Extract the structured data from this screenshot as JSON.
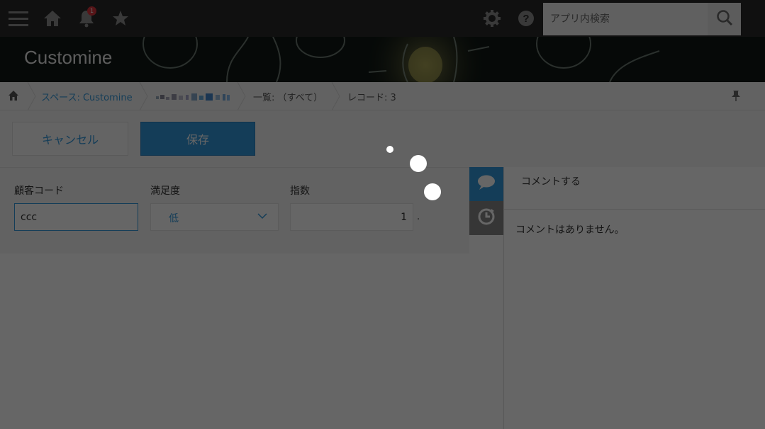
{
  "topbar": {
    "notification_count": "1",
    "search": {
      "placeholder": "アプリ内検索"
    }
  },
  "header": {
    "title": "Customine"
  },
  "breadcrumb": {
    "space": "スペース: Customine",
    "list": "一覧: （すべて）",
    "record": "レコード: 3"
  },
  "toolbar": {
    "cancel_label": "キャンセル",
    "save_label": "保存"
  },
  "form": {
    "customer_code": {
      "label": "顧客コード",
      "value": "ccc"
    },
    "satisfaction": {
      "label": "満足度",
      "value": "低"
    },
    "index": {
      "label": "指数",
      "value": "1",
      "suffix": "."
    }
  },
  "comments": {
    "input_placeholder": "コメントする",
    "empty_text": "コメントはありません。"
  },
  "colors": {
    "accent": "#3498db",
    "topbar": "#2a2a2a",
    "badge": "#d9363e"
  },
  "icons": [
    "menu-icon",
    "home-icon",
    "bell-icon",
    "star-icon",
    "gear-icon",
    "help-icon",
    "search-icon",
    "pin-icon",
    "comment-icon",
    "history-icon",
    "chevron-down-icon"
  ]
}
